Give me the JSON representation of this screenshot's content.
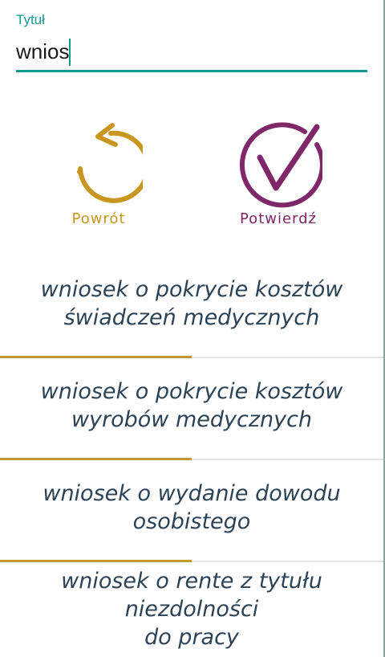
{
  "title_field": {
    "label": "Tytuł",
    "value": "wnios"
  },
  "actions": {
    "back": {
      "label": "Powrót",
      "icon": "undo-arrow-icon",
      "color": "#c8961e"
    },
    "confirm": {
      "label": "Potwierdź",
      "icon": "check-circle-icon",
      "color": "#80266a"
    }
  },
  "results": [
    {
      "line1": "wniosek o pokrycie kosztów",
      "line2": "świadczeń medycznych"
    },
    {
      "line1": "wniosek o pokrycie kosztów",
      "line2": "wyrobów medycznych"
    },
    {
      "line1": "wniosek o wydanie dowodu",
      "line2": "osobistego"
    },
    {
      "line1": "wniosek o rente z tytułu niezdolności",
      "line2": "do pracy"
    }
  ],
  "colors": {
    "accent": "#0e9a8e",
    "list_text": "#2c4357",
    "separator_accent": "#c09a2e"
  }
}
